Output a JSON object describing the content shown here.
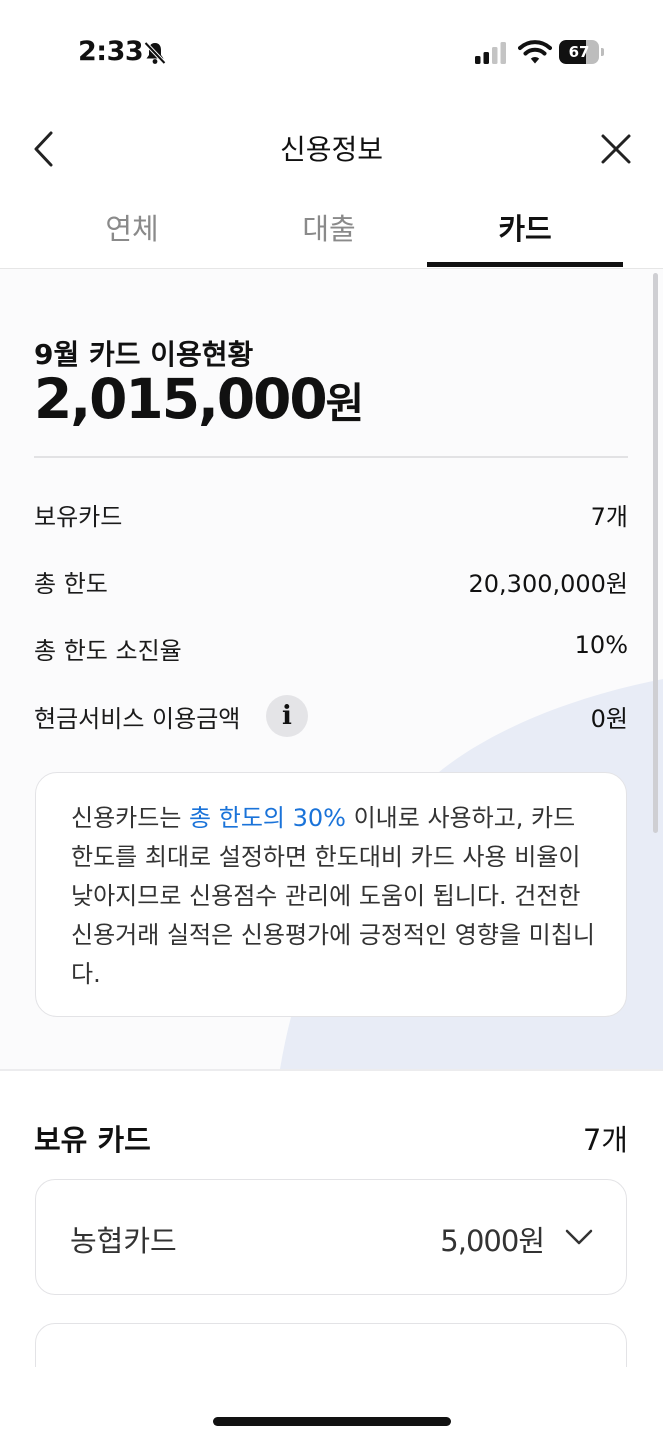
{
  "status_bar": {
    "time": "2:33",
    "battery_level": "67",
    "icons": [
      "bell-muted-icon",
      "cellular-signal-icon",
      "wifi-icon",
      "battery-icon"
    ]
  },
  "nav": {
    "title": "신용정보",
    "back_icon": "chevron-left-icon",
    "close_icon": "close-icon"
  },
  "tabs": [
    {
      "label": "연체",
      "active": false
    },
    {
      "label": "대출",
      "active": false
    },
    {
      "label": "카드",
      "active": true
    }
  ],
  "summary": {
    "month_label": "9월 카드 이용현황",
    "amount": "2,015,000",
    "amount_unit": "원",
    "rows": [
      {
        "label": "보유카드",
        "value": "7개"
      },
      {
        "label": "총 한도",
        "value": "20,300,000원"
      },
      {
        "label": "총 한도 소진율",
        "value": "10%"
      },
      {
        "label": "현금서비스 이용금액",
        "value": "0원",
        "info_icon": "info-icon"
      }
    ]
  },
  "tip": {
    "prefix": "신용카드는 ",
    "highlight": "총 한도의 30%",
    "suffix": " 이내로 사용하고, 카드 한도를 최대로 설정하면 한도대비 카드 사용 비율이 낮아지므로 신용점수 관리에 도움이 됩니다. 건전한 신용거래 실적은 신용평가에 긍정적인 영향을 미칩니다."
  },
  "cards": {
    "title": "보유 카드",
    "count": "7개",
    "items": [
      {
        "name": "농협카드",
        "amount": "5,000원",
        "icon": "chevron-down-icon"
      }
    ]
  },
  "colors": {
    "accent_blue": "#1a73d9",
    "text_primary": "#111111",
    "tab_inactive": "#8a8a8a",
    "section_bg": "#fbfbfc"
  }
}
